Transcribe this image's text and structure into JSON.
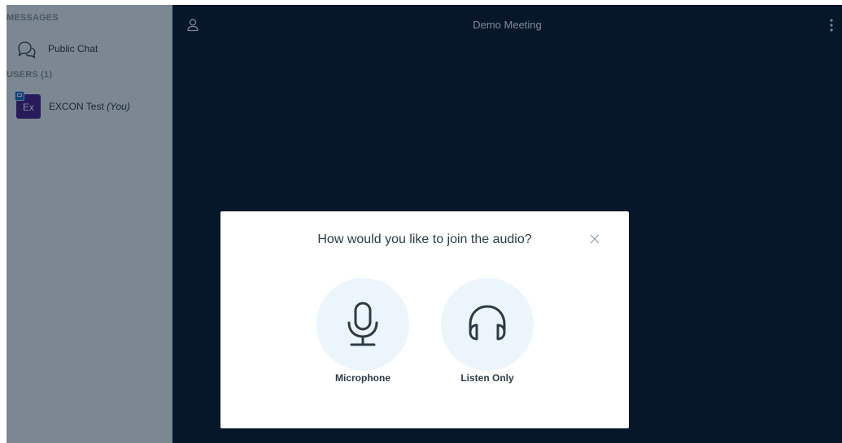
{
  "sidebar": {
    "messages_heading": "MESSAGES",
    "public_chat_label": "Public Chat",
    "users_heading": "USERS (1)",
    "user": {
      "avatar_initials": "Ex",
      "name": "EXCON Test",
      "you_label": "(You)",
      "avatar_color": "#4a1e8c"
    }
  },
  "header": {
    "meeting_title": "Demo Meeting"
  },
  "audio_modal": {
    "title": "How would you like to join the audio?",
    "options": [
      {
        "label": "Microphone",
        "icon": "microphone-icon"
      },
      {
        "label": "Listen Only",
        "icon": "headphones-icon"
      }
    ]
  },
  "colors": {
    "background_dark": "#06172a",
    "sidebar_bg": "#f3f6f9",
    "option_circle_bg": "#ecf4fc",
    "icon_stroke": "#2d3b47"
  }
}
